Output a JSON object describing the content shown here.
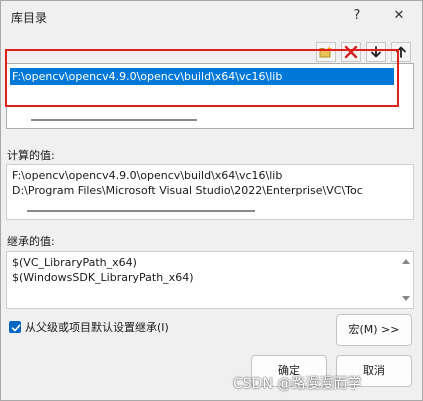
{
  "window": {
    "title": "库目录",
    "help_glyph": "?",
    "close_glyph": "✕"
  },
  "toolbar": {
    "icons": [
      "new-folder-icon",
      "delete-icon",
      "move-down-icon",
      "move-up-icon"
    ]
  },
  "paths_list": {
    "items": [
      "F:\\opencv\\opencv4.9.0\\opencv\\build\\x64\\vc16\\lib"
    ]
  },
  "computed": {
    "label": "计算的值:",
    "lines": [
      "F:\\opencv\\opencv4.9.0\\opencv\\build\\x64\\vc16\\lib",
      "D:\\Program Files\\Microsoft Visual Studio\\2022\\Enterprise\\VC\\Toc"
    ]
  },
  "inherited": {
    "label": "继承的值:",
    "lines": [
      "$(VC_LibraryPath_x64)",
      "$(WindowsSDK_LibraryPath_x64)"
    ]
  },
  "inherit_checkbox": {
    "label": "从父级或项目默认设置继承(I)",
    "checked": true
  },
  "buttons": {
    "macro": "宏(M) >>",
    "ok": "确定",
    "cancel": "取消"
  },
  "watermark": "CSDN @路漫漫而学",
  "colors": {
    "selection": "#0078d7",
    "highlight_box": "#e0201e",
    "checkbox": "#0067c0"
  }
}
